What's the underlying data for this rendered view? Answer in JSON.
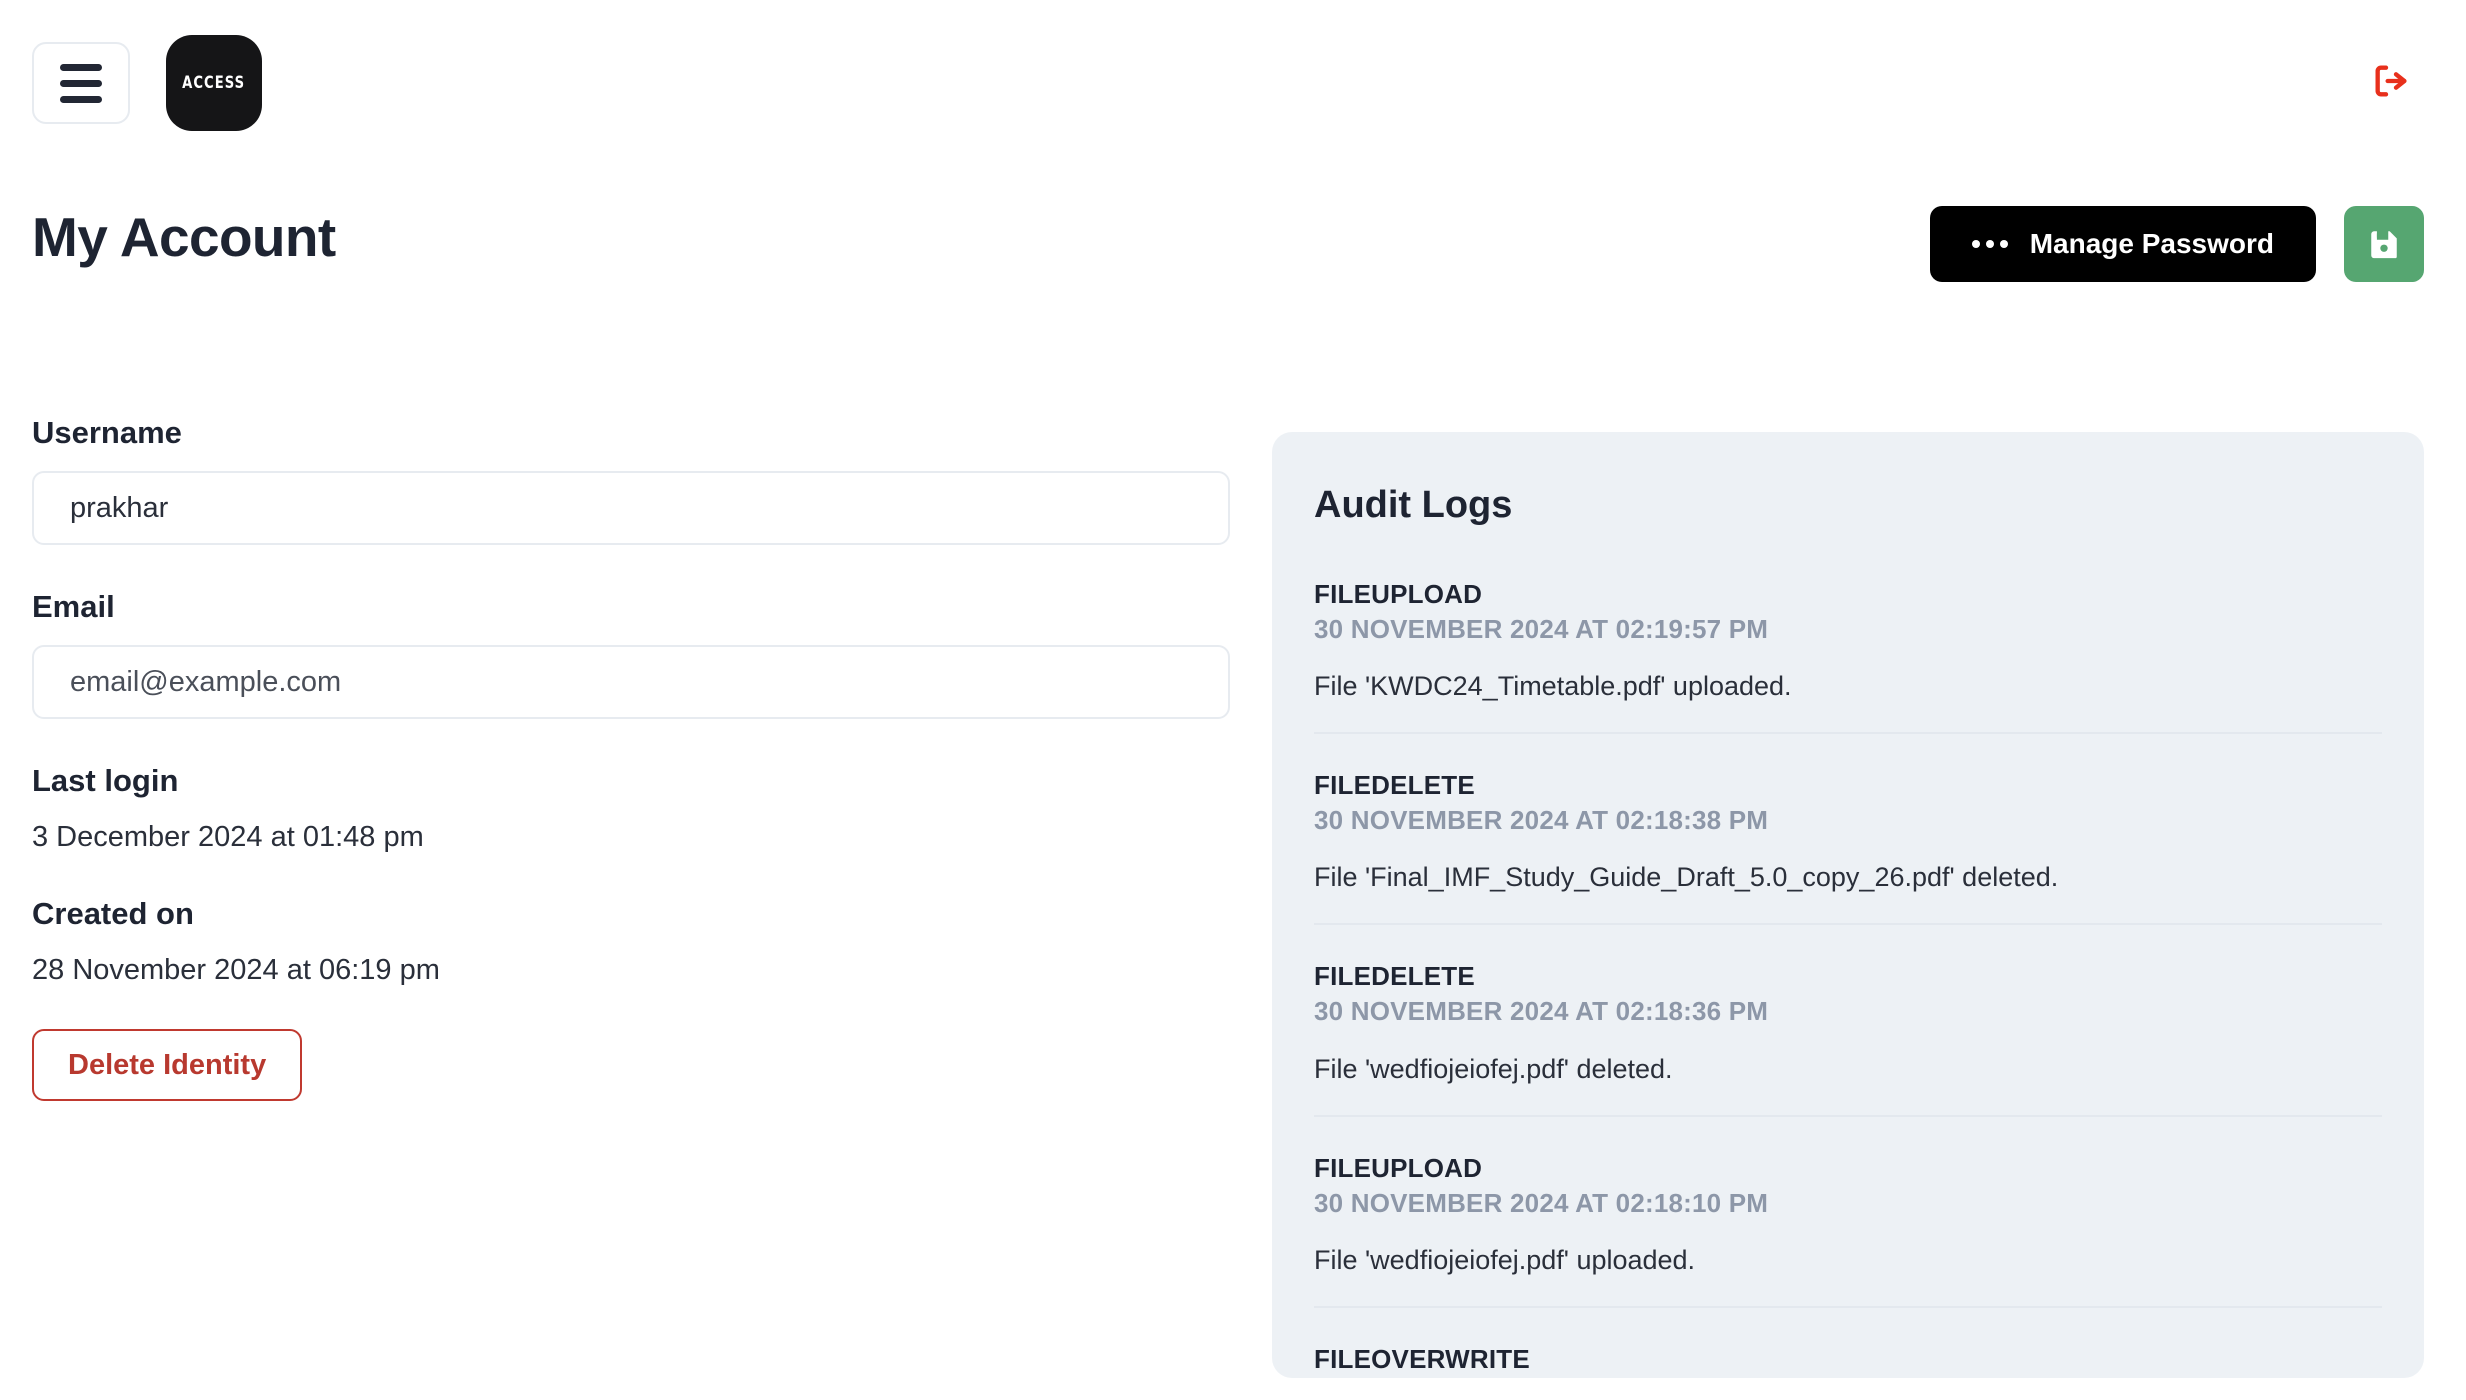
{
  "topbar": {
    "menu_icon": "hamburger-menu-icon",
    "logo_text": "ACCESS",
    "logout_icon": "logout-icon",
    "logout_color": "#e8301c"
  },
  "header": {
    "title": "My Account",
    "manage_password_label": "Manage Password",
    "manage_password_icon": "three-dots-icon",
    "save_icon": "floppy-disk-save-icon",
    "save_button_color": "#56a671",
    "manage_button_color": "#000000"
  },
  "form": {
    "username_label": "Username",
    "username_value": "prakhar",
    "email_label": "Email",
    "email_placeholder": "email@example.com",
    "last_login_label": "Last login",
    "last_login_value": "3 December 2024 at 01:48 pm",
    "created_on_label": "Created on",
    "created_on_value": "28 November 2024 at 06:19 pm",
    "delete_label": "Delete Identity",
    "delete_color": "#b8392f"
  },
  "audit": {
    "title": "Audit Logs",
    "panel_color": "#edf1f5",
    "logs": [
      {
        "action": "FILEUPLOAD",
        "timestamp": "30 NOVEMBER 2024 AT 02:19:57 PM",
        "description": "File 'KWDC24_Timetable.pdf' uploaded."
      },
      {
        "action": "FILEDELETE",
        "timestamp": "30 NOVEMBER 2024 AT 02:18:38 PM",
        "description": "File 'Final_IMF_Study_Guide_Draft_5.0_copy_26.pdf' deleted."
      },
      {
        "action": "FILEDELETE",
        "timestamp": "30 NOVEMBER 2024 AT 02:18:36 PM",
        "description": "File 'wedfiojeiofej.pdf' deleted."
      },
      {
        "action": "FILEUPLOAD",
        "timestamp": "30 NOVEMBER 2024 AT 02:18:10 PM",
        "description": "File 'wedfiojeiofej.pdf' uploaded."
      },
      {
        "action": "FILEOVERWRITE",
        "timestamp": "",
        "description": ""
      }
    ]
  }
}
